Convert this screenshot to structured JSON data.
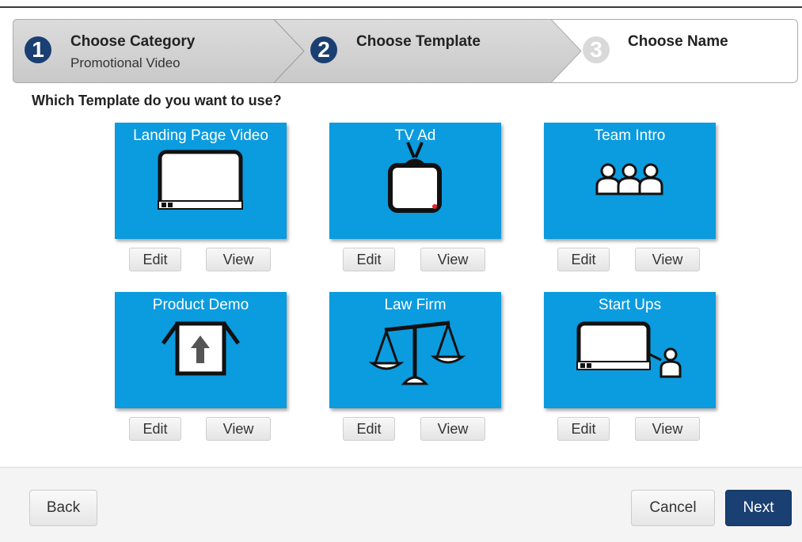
{
  "wizard": {
    "steps": [
      {
        "number": "1",
        "title": "Choose Category",
        "subtitle": "Promotional Video",
        "state": "done"
      },
      {
        "number": "2",
        "title": "Choose Template",
        "subtitle": "",
        "state": "current"
      },
      {
        "number": "3",
        "title": "Choose Name",
        "subtitle": "",
        "state": "upcoming"
      }
    ]
  },
  "question": "Which Template do you want to use?",
  "templates": [
    {
      "label": "Landing Page Video",
      "icon": "monitor-icon",
      "edit_label": "Edit",
      "view_label": "View"
    },
    {
      "label": "TV Ad",
      "icon": "tv-icon",
      "edit_label": "Edit",
      "view_label": "View"
    },
    {
      "label": "Team Intro",
      "icon": "team-icon",
      "edit_label": "Edit",
      "view_label": "View"
    },
    {
      "label": "Product Demo",
      "icon": "product-box-icon",
      "edit_label": "Edit",
      "view_label": "View"
    },
    {
      "label": "Law Firm",
      "icon": "scales-icon",
      "edit_label": "Edit",
      "view_label": "View"
    },
    {
      "label": "Start Ups",
      "icon": "presentation-icon",
      "edit_label": "Edit",
      "view_label": "View"
    }
  ],
  "footer": {
    "back_label": "Back",
    "cancel_label": "Cancel",
    "next_label": "Next"
  },
  "colors": {
    "card_blue": "#0b9bdf",
    "primary_navy": "#1a3f72",
    "step_done_bg": "#cdcdcd",
    "step_upcoming_bg": "#ffffff"
  }
}
